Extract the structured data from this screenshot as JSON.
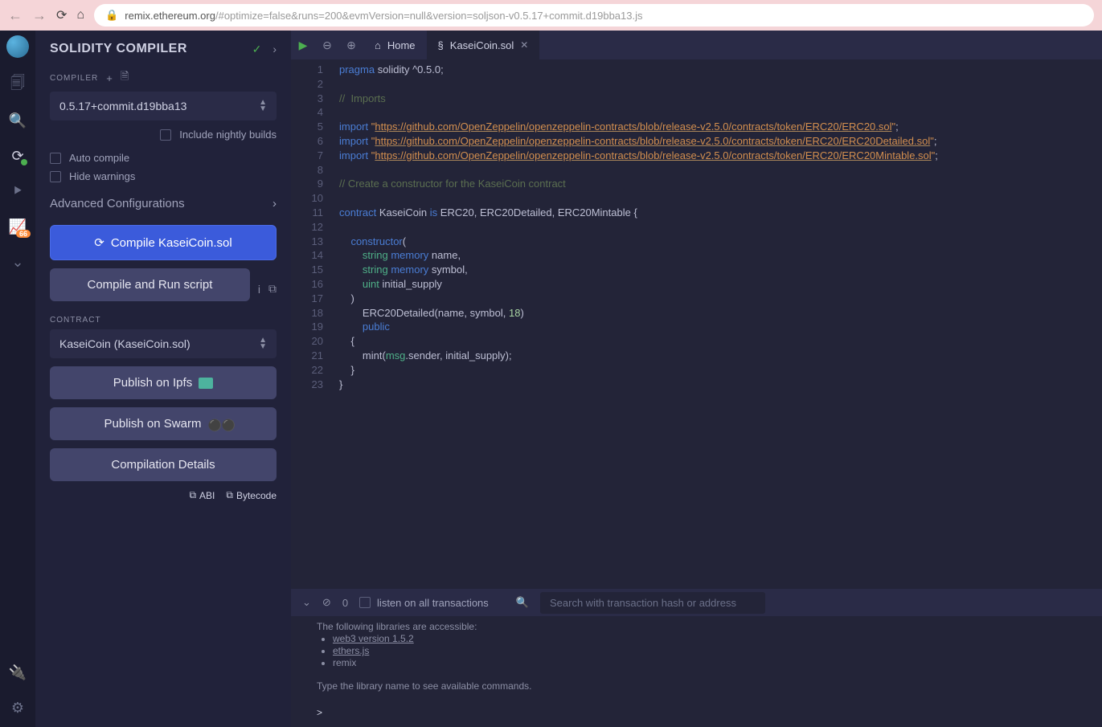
{
  "url": {
    "host": "remix.ethereum.org",
    "path": "/#optimize=false&runs=200&evmVersion=null&version=soljson-v0.5.17+commit.d19bba13.js"
  },
  "rail": {
    "badge": "66"
  },
  "panel": {
    "title": "SOLIDITY COMPILER",
    "compiler_label": "COMPILER",
    "compiler_version": "0.5.17+commit.d19bba13",
    "nightly": "Include nightly builds",
    "auto_compile": "Auto compile",
    "hide_warnings": "Hide warnings",
    "advanced": "Advanced Configurations",
    "compile_btn": "Compile KaseiCoin.sol",
    "compile_run": "Compile and Run script",
    "contract_label": "CONTRACT",
    "contract_selected": "KaseiCoin (KaseiCoin.sol)",
    "publish_ipfs": "Publish on Ipfs",
    "publish_swarm": "Publish on Swarm",
    "details": "Compilation Details",
    "abi": "ABI",
    "bytecode": "Bytecode"
  },
  "tabs": {
    "home": "Home",
    "file": "KaseiCoin.sol"
  },
  "code_lines": [
    {
      "n": 1,
      "html": "<span class='tk-kw'>pragma</span> <span class='tk-id'>solidity</span> <span class='tk-w'>^0.5.0;</span>"
    },
    {
      "n": 2,
      "html": ""
    },
    {
      "n": 3,
      "html": "<span class='tk-cm'>//  Imports</span>"
    },
    {
      "n": 4,
      "html": ""
    },
    {
      "n": 5,
      "html": "<span class='tk-kw'>import</span> <span class='tk-str'>\"</span><span class='tk-link'>https://github.com/OpenZeppelin/openzeppelin-contracts/blob/release-v2.5.0/contracts/token/ERC20/ERC20.sol</span><span class='tk-str'>\"</span><span class='tk-w'>;</span>"
    },
    {
      "n": 6,
      "html": "<span class='tk-kw'>import</span> <span class='tk-str'>\"</span><span class='tk-link'>https://github.com/OpenZeppelin/openzeppelin-contracts/blob/release-v2.5.0/contracts/token/ERC20/ERC20Detailed.sol</span><span class='tk-str'>\"</span><span class='tk-w'>;</span>"
    },
    {
      "n": 7,
      "html": "<span class='tk-kw'>import</span> <span class='tk-str'>\"</span><span class='tk-link'>https://github.com/OpenZeppelin/openzeppelin-contracts/blob/release-v2.5.0/contracts/token/ERC20/ERC20Mintable.sol</span><span class='tk-str'>\"</span><span class='tk-w'>;</span>"
    },
    {
      "n": 8,
      "html": ""
    },
    {
      "n": 9,
      "html": "<span class='tk-cm'>// Create a constructor for the KaseiCoin contract</span>"
    },
    {
      "n": 10,
      "html": ""
    },
    {
      "n": 11,
      "html": "<span class='tk-kw'>contract</span> <span class='tk-id'>KaseiCoin</span> <span class='tk-kw'>is</span> <span class='tk-id'>ERC20</span><span class='tk-w'>,</span> <span class='tk-id'>ERC20Detailed</span><span class='tk-w'>,</span> <span class='tk-id'>ERC20Mintable</span> <span class='tk-w'>{</span>"
    },
    {
      "n": 12,
      "html": ""
    },
    {
      "n": 13,
      "html": "    <span class='tk-kw'>constructor</span><span class='tk-w'>(</span>"
    },
    {
      "n": 14,
      "html": "        <span class='tk-ty'>string</span> <span class='tk-kw'>memory</span> <span class='tk-id'>name</span><span class='tk-w'>,</span>"
    },
    {
      "n": 15,
      "html": "        <span class='tk-ty'>string</span> <span class='tk-kw'>memory</span> <span class='tk-id'>symbol</span><span class='tk-w'>,</span>"
    },
    {
      "n": 16,
      "html": "        <span class='tk-ty'>uint</span> <span class='tk-id'>initial_supply</span>"
    },
    {
      "n": 17,
      "html": "    <span class='tk-w'>)</span>"
    },
    {
      "n": 18,
      "html": "        <span class='tk-id'>ERC20Detailed</span><span class='tk-w'>(name, symbol,</span> <span class='tk-nm'>18</span><span class='tk-w'>)</span>"
    },
    {
      "n": 19,
      "html": "        <span class='tk-kw'>public</span>"
    },
    {
      "n": 20,
      "html": "    <span class='tk-w'>{</span>"
    },
    {
      "n": 21,
      "html": "        <span class='tk-id'>mint</span><span class='tk-w'>(</span><span class='tk-ty'>msg</span><span class='tk-w'>.sender, initial_supply);</span>"
    },
    {
      "n": 22,
      "html": "    <span class='tk-w'>}</span>"
    },
    {
      "n": 23,
      "html": "<span class='tk-w'>}</span>"
    }
  ],
  "console": {
    "zero": "0",
    "listen": "listen on all transactions",
    "search_ph": "Search with transaction hash or address",
    "line1": "The following libraries are accessible:",
    "libs": [
      "web3 version 1.5.2",
      "ethers.js",
      "remix"
    ],
    "hint": "Type the library name to see available commands.",
    "prompt": ">"
  }
}
